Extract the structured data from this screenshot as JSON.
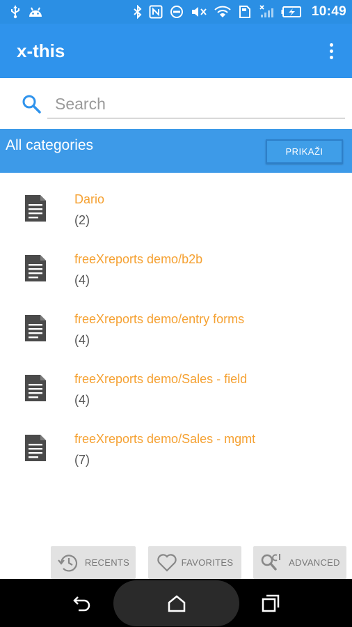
{
  "status_bar": {
    "time": "10:49",
    "icons": [
      "usb-icon",
      "android-icon",
      "bluetooth-icon",
      "nfc-icon",
      "do-not-disturb-icon",
      "mute-icon",
      "wifi-icon",
      "sd-card-icon",
      "no-signal-icon",
      "battery-charging-icon"
    ]
  },
  "app_bar": {
    "title": "x-this",
    "menu_icon": "overflow-menu-icon"
  },
  "search": {
    "placeholder": "Search",
    "value": ""
  },
  "category_bar": {
    "title": "All categories",
    "button_label": "PRIKAŽI"
  },
  "categories": [
    {
      "name": "Dario",
      "count": "(2)"
    },
    {
      "name": "freeXreports demo/b2b",
      "count": "(4)"
    },
    {
      "name": "freeXreports demo/entry forms",
      "count": "(4)"
    },
    {
      "name": "freeXreports demo/Sales - field",
      "count": "(4)"
    },
    {
      "name": "freeXreports demo/Sales - mgmt",
      "count": "(7)"
    }
  ],
  "bottom_tabs": {
    "recents": "RECENTS",
    "favorites": "FAVORITES",
    "advanced": "ADVANCED"
  },
  "colors": {
    "status_bar": "#2b8fe4",
    "app_bar": "#2f93ec",
    "category_bar": "#3d9ae8",
    "item_title": "#f5a132",
    "search_icon": "#2f93ec"
  }
}
